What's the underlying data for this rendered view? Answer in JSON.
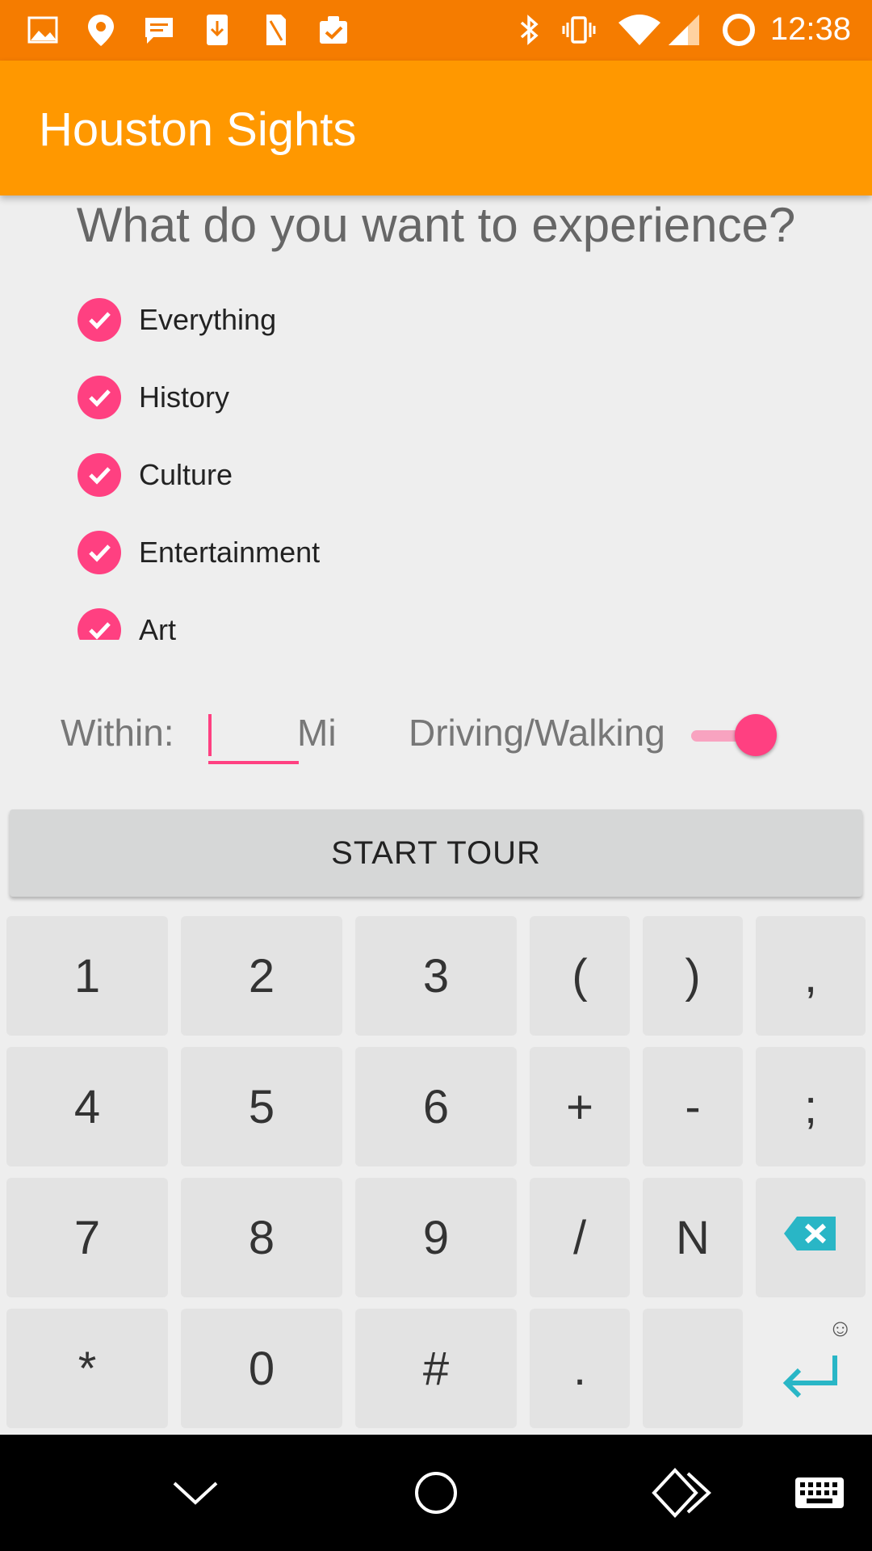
{
  "status_bar": {
    "time": "12:38",
    "left_icons": [
      "image-icon",
      "location-icon",
      "message-icon",
      "download-icon",
      "sim-icon",
      "clipboard-check-icon"
    ],
    "right_icons": [
      "bluetooth-icon",
      "vibrate-icon",
      "wifi-icon",
      "signal-icon",
      "battery-ring-icon"
    ]
  },
  "app_bar": {
    "title": "Houston Sights",
    "color": "#ff9800"
  },
  "question": "What do you want to experience?",
  "categories": [
    {
      "label": "Everything",
      "checked": true
    },
    {
      "label": "History",
      "checked": true
    },
    {
      "label": "Culture",
      "checked": true
    },
    {
      "label": "Entertainment",
      "checked": true
    },
    {
      "label": "Art",
      "checked": true
    }
  ],
  "distance": {
    "label": "Within:",
    "value": "",
    "unit": "Mi"
  },
  "mode": {
    "label": "Driving/Walking",
    "switch_on": true
  },
  "start_button": "START TOUR",
  "keyboard": {
    "rows": [
      [
        "1",
        "2",
        "3",
        "(",
        ")",
        ","
      ],
      [
        "4",
        "5",
        "6",
        "+",
        "-",
        ";"
      ],
      [
        "7",
        "8",
        "9",
        "/",
        "N",
        "backspace"
      ],
      [
        "*",
        "0",
        "#",
        ".",
        "",
        "enter"
      ]
    ],
    "emoji": "☺",
    "accent": "#29b6c6"
  },
  "nav_bar": {
    "buttons": [
      "back-chevron-icon",
      "home-circle-icon",
      "recents-icon",
      "keyboard-icon"
    ]
  },
  "colors": {
    "accent": "#ff4081",
    "status_bar": "#f57c00"
  }
}
